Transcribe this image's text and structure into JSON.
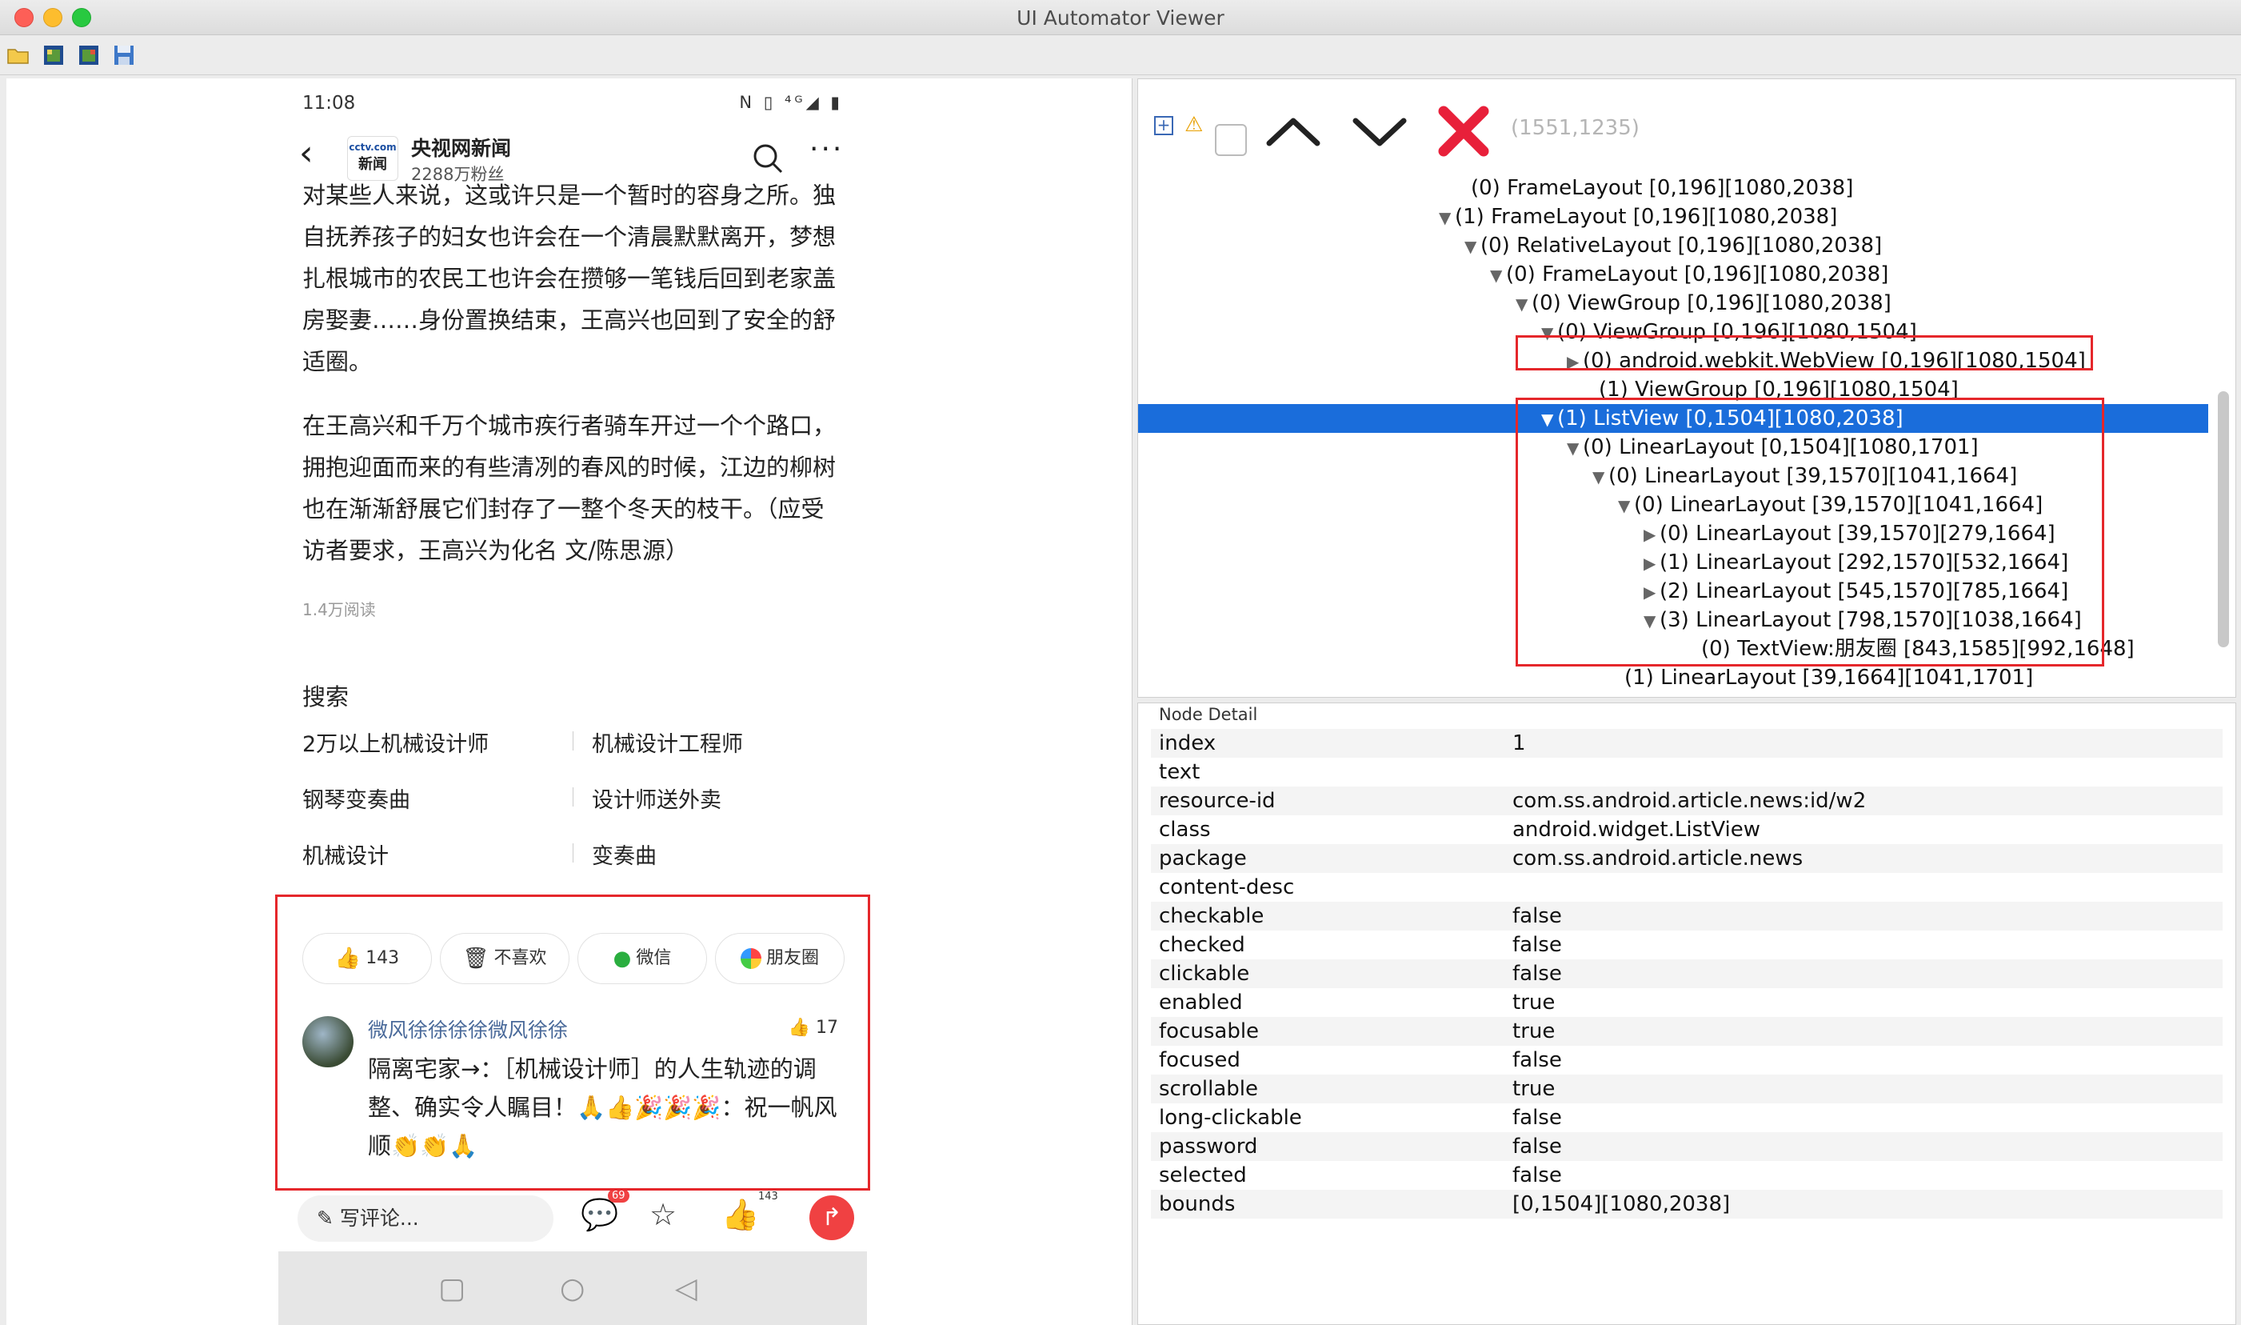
{
  "window": {
    "title": "UI Automator Viewer"
  },
  "toolbar": {
    "icons": [
      "open-folder-icon",
      "device-screenshot-icon",
      "device-screenshot-compressed-icon",
      "save-icon"
    ]
  },
  "phone": {
    "status_time": "11:08",
    "status_icons": "N ▯ ⁴ᴳ◢ ▮",
    "header": {
      "logo_line1": "cctv.com",
      "logo_line2": "新闻",
      "author": "央视网新闻",
      "fans": "2288万粉丝"
    },
    "article": {
      "paragraphs": [
        "对某些人来说，这或许只是一个暂时的容身之所。独自抚养孩子的妇女也许会在一个清晨默默离开，梦想扎根城市的农民工也许会在攒够一笔钱后回到老家盖房娶妻……身份置换结束，王高兴也回到了安全的舒适圈。",
        "在王高兴和千万个城市疾行者骑车开过一个个路口，拥抱迎面而来的有些清冽的春风的时候，江边的柳树也在渐渐舒展它们封存了一整个冬天的枝干。（应受访者要求，王高兴为化名 文/陈思源）"
      ],
      "read_count": "1.4万阅读"
    },
    "search": {
      "title": "搜索",
      "rows": [
        {
          "left": "2万以上机械设计师",
          "right": "机械设计工程师"
        },
        {
          "left": "钢琴变奏曲",
          "right": "设计师送外卖"
        },
        {
          "left": "机械设计",
          "right": "变奏曲"
        }
      ]
    },
    "actions": {
      "like": "143",
      "dislike": "不喜欢",
      "wechat": "微信",
      "moments": "朋友圈"
    },
    "comment": {
      "name": "微风徐徐徐徐微风徐徐",
      "likes": "17",
      "text": "隔离宅家→：［机械设计师］的人生轨迹的调整、确实令人瞩目！🙏👍🎉🎉🎉：祝一帆风顺👏👏🙏"
    },
    "bottom": {
      "write_placeholder": "写评论...",
      "comment_badge": "69",
      "like_count": "143"
    }
  },
  "tree_toolbar": {
    "coords": "(1551,1235)"
  },
  "tree": {
    "rows": [
      {
        "arrow": "",
        "text": "(0) FrameLayout [0,196][1080,2038]",
        "selected": false
      },
      {
        "arrow": "▼",
        "text": "(1) FrameLayout [0,196][1080,2038]",
        "selected": false
      },
      {
        "arrow": "▼",
        "text": "(0) RelativeLayout [0,196][1080,2038]",
        "selected": false
      },
      {
        "arrow": "▼",
        "text": "(0) FrameLayout [0,196][1080,2038]",
        "selected": false
      },
      {
        "arrow": "▼",
        "text": "(0) ViewGroup [0,196][1080,2038]",
        "selected": false
      },
      {
        "arrow": "▼",
        "text": "(0) ViewGroup [0,196][1080,1504]",
        "selected": false
      },
      {
        "arrow": "▶",
        "text": "(0) android.webkit.WebView [0,196][1080,1504]",
        "selected": false
      },
      {
        "arrow": "",
        "text": "(1) ViewGroup [0,196][1080,1504]",
        "selected": false
      },
      {
        "arrow": "▼",
        "text": "(1) ListView [0,1504][1080,2038]",
        "selected": true
      },
      {
        "arrow": "▼",
        "text": "(0) LinearLayout [0,1504][1080,1701]",
        "selected": false
      },
      {
        "arrow": "▼",
        "text": "(0) LinearLayout [39,1570][1041,1664]",
        "selected": false
      },
      {
        "arrow": "▼",
        "text": "(0) LinearLayout [39,1570][1041,1664]",
        "selected": false
      },
      {
        "arrow": "▶",
        "text": "(0) LinearLayout [39,1570][279,1664]",
        "selected": false
      },
      {
        "arrow": "▶",
        "text": "(1) LinearLayout [292,1570][532,1664]",
        "selected": false
      },
      {
        "arrow": "▶",
        "text": "(2) LinearLayout [545,1570][785,1664]",
        "selected": false
      },
      {
        "arrow": "▼",
        "text": "(3) LinearLayout [798,1570][1038,1664]",
        "selected": false
      },
      {
        "arrow": "",
        "text": "(0) TextView:朋友圈 [843,1585][992,1648]",
        "selected": false
      },
      {
        "arrow": "",
        "text": "(1) LinearLayout [39,1664][1041,1701]",
        "selected": false
      }
    ]
  },
  "detail": {
    "title": "Node Detail",
    "rows": [
      {
        "key": "index",
        "value": "1"
      },
      {
        "key": "text",
        "value": ""
      },
      {
        "key": "resource-id",
        "value": "com.ss.android.article.news:id/w2"
      },
      {
        "key": "class",
        "value": "android.widget.ListView"
      },
      {
        "key": "package",
        "value": "com.ss.android.article.news"
      },
      {
        "key": "content-desc",
        "value": ""
      },
      {
        "key": "checkable",
        "value": "false"
      },
      {
        "key": "checked",
        "value": "false"
      },
      {
        "key": "clickable",
        "value": "false"
      },
      {
        "key": "enabled",
        "value": "true"
      },
      {
        "key": "focusable",
        "value": "true"
      },
      {
        "key": "focused",
        "value": "false"
      },
      {
        "key": "scrollable",
        "value": "true"
      },
      {
        "key": "long-clickable",
        "value": "false"
      },
      {
        "key": "password",
        "value": "false"
      },
      {
        "key": "selected",
        "value": "false"
      },
      {
        "key": "bounds",
        "value": "[0,1504][1080,2038]"
      }
    ]
  }
}
